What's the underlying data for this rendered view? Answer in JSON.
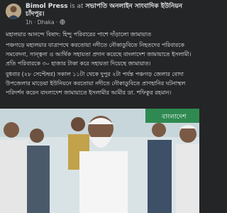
{
  "post": {
    "author": "Bimol Press",
    "verb": "is at",
    "location_line1": "সভাপতি অনলাইন সাংবাদিক ইউনিয়ন",
    "location_line2": "চাঁদপুর।",
    "time": "1h",
    "place": "Dhaka",
    "privacy_icon": "globe-icon",
    "paragraphs": [
      "মহালয়ার আনন্দে বিষাদ: হিন্দু পরিবারের পাশে দাঁড়ালো জামায়াত",
      "পঞ্চগড়ে মহালয়ার যাত্রাপথে করতোয়া নদীতে নৌকাডুবিতে নিহতদের পরিবারকে সমবেদনা, সান্ত্বনা ও আর্থিক সহায়তা প্রদান করেছে বাংলাদেশ জামায়াতে ইসলামী। প্রতি পরিবারকে ৩০ হাজার টাকা করে সহায়তা দিয়েছে জামায়াত।",
      "বুধবার (২৮ সেপ্টেম্বর) সকাল ১১টা থেকে দুপুর ২টা পর্যন্ত পঞ্চগড় জেলার বোদা উপজেলার মাড়েয়া ইউনিয়নে করতোয়া নদীতে নৌকাডুবিতে প্রাণহানির ঘটনাস্থল পরিদর্শন করেন বাংলাদেশ জামায়াতে ইসলামীর আমীর ডা. শফিকুর রহমান।"
    ]
  },
  "photo": {
    "banner_text": "বাংলাদেশ"
  },
  "colors": {
    "background": "#242526",
    "text": "#e4e6eb",
    "secondary": "#b0b3b8"
  }
}
